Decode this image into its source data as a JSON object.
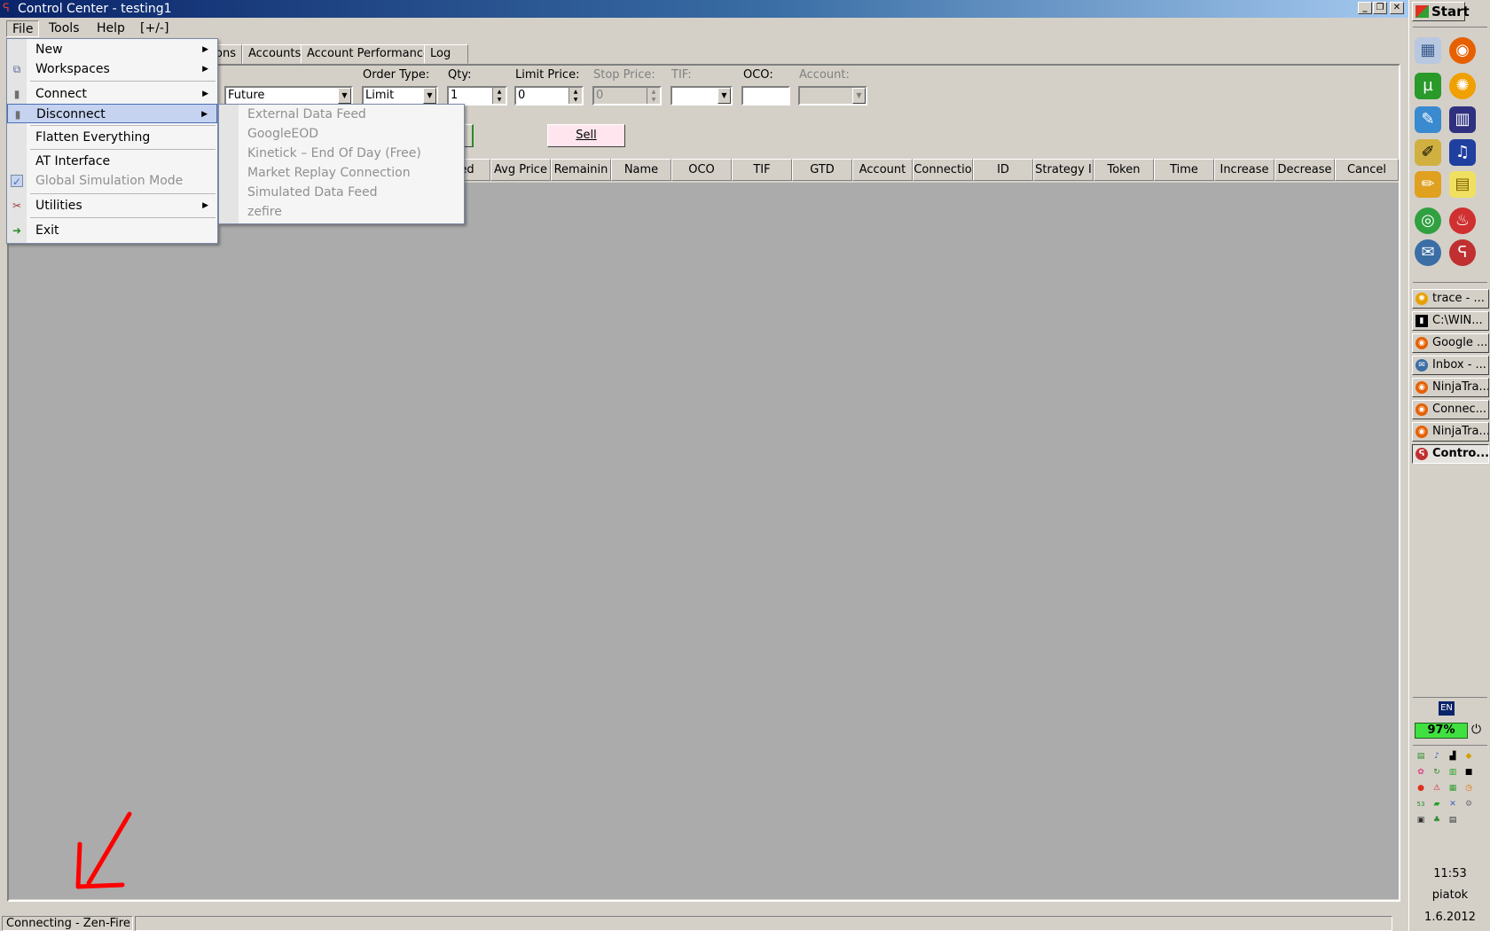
{
  "window": {
    "title": "Control Center - testing1",
    "buttons": {
      "minimize": "_",
      "restore": "❐",
      "close": "✕"
    }
  },
  "menubar": [
    {
      "label": "File"
    },
    {
      "label": "Tools"
    },
    {
      "label": "Help"
    },
    {
      "label": "[+/-]"
    }
  ],
  "tabs": [
    {
      "label": "ons"
    },
    {
      "label": "Accounts"
    },
    {
      "label": "Account Performance"
    },
    {
      "label": "Log"
    }
  ],
  "order_entry": {
    "instrument_type": "Future",
    "order_type_label": "Order Type:",
    "order_type": "Limit",
    "qty_label": "Qty:",
    "qty": "1",
    "limit_price_label": "Limit Price:",
    "limit_price": "0",
    "stop_price_label": "Stop Price:",
    "stop_price": "0",
    "tif_label": "TIF:",
    "tif": "",
    "oco_label": "OCO:",
    "oco": "",
    "account_label": "Account:",
    "account": "",
    "sell_label": "Sell"
  },
  "grid": {
    "columns": [
      "ed",
      "Avg Price",
      "Remainin",
      "Name",
      "OCO",
      "TIF",
      "GTD",
      "Account",
      "Connectio",
      "ID",
      "Strategy I",
      "Token",
      "Time",
      "Increase",
      "Decrease",
      "Cancel"
    ]
  },
  "file_menu": {
    "items": [
      {
        "label": "New",
        "has_submenu": true,
        "enabled": true
      },
      {
        "label": "Workspaces",
        "has_submenu": true,
        "enabled": true,
        "icon": "workspaces-icon"
      },
      {
        "label": "Connect",
        "has_submenu": true,
        "enabled": true,
        "icon": "plug-icon"
      },
      {
        "label": "Disconnect",
        "has_submenu": true,
        "enabled": true,
        "highlighted": true,
        "icon": "unplug-icon"
      },
      {
        "label": "Flatten Everything",
        "has_submenu": false,
        "enabled": true
      },
      {
        "label": "AT Interface",
        "has_submenu": false,
        "enabled": true
      },
      {
        "label": "Global Simulation Mode",
        "has_submenu": false,
        "enabled": false,
        "checked": true
      },
      {
        "label": "Utilities",
        "has_submenu": true,
        "enabled": true,
        "icon": "tools-icon"
      },
      {
        "label": "Exit",
        "has_submenu": false,
        "enabled": true,
        "icon": "exit-icon"
      }
    ]
  },
  "disconnect_submenu": {
    "items": [
      {
        "label": "External Data Feed",
        "enabled": false
      },
      {
        "label": "GoogleEOD",
        "enabled": false
      },
      {
        "label": "Kinetick – End Of Day (Free)",
        "enabled": false
      },
      {
        "label": "Market Replay Connection",
        "enabled": false
      },
      {
        "label": "Simulated Data Feed",
        "enabled": false
      },
      {
        "label": "zefire",
        "enabled": false
      }
    ]
  },
  "status_bar": {
    "text": "Connecting - Zen-Fire",
    "annotation": "red-arrow"
  },
  "taskbar": {
    "start_label": "Start",
    "windows": [
      {
        "label": "trace - ...",
        "icon": "trace-icon",
        "color": "#e8a000"
      },
      {
        "label": "C:\\WIN...",
        "icon": "cmd-icon",
        "color": "#000000"
      },
      {
        "label": "Google ...",
        "icon": "firefox-icon",
        "color": "#e66000"
      },
      {
        "label": "Inbox - ...",
        "icon": "thunderbird-icon",
        "color": "#3a6ea5"
      },
      {
        "label": "NinjaTra...",
        "icon": "firefox-icon",
        "color": "#e66000"
      },
      {
        "label": "Connec...",
        "icon": "firefox-icon",
        "color": "#e66000"
      },
      {
        "label": "NinjaTra...",
        "icon": "firefox-icon",
        "color": "#e66000"
      },
      {
        "label": "Contro...",
        "icon": "ninjatrader-icon",
        "color": "#c03030",
        "active": true
      }
    ],
    "language": "EN",
    "battery": "97%",
    "time": "11:53",
    "day": "piatok",
    "date": "1.6.2012"
  },
  "colors": {
    "title_start": "#0a246a",
    "title_end": "#a6caf0",
    "face": "#d4d0c8",
    "grid_bg": "#ababab",
    "menu_highlight": "#c5d3f0",
    "sell_bg": "#ffe6ee",
    "battery_green": "#40e040",
    "annotation_red": "#ff0000"
  }
}
